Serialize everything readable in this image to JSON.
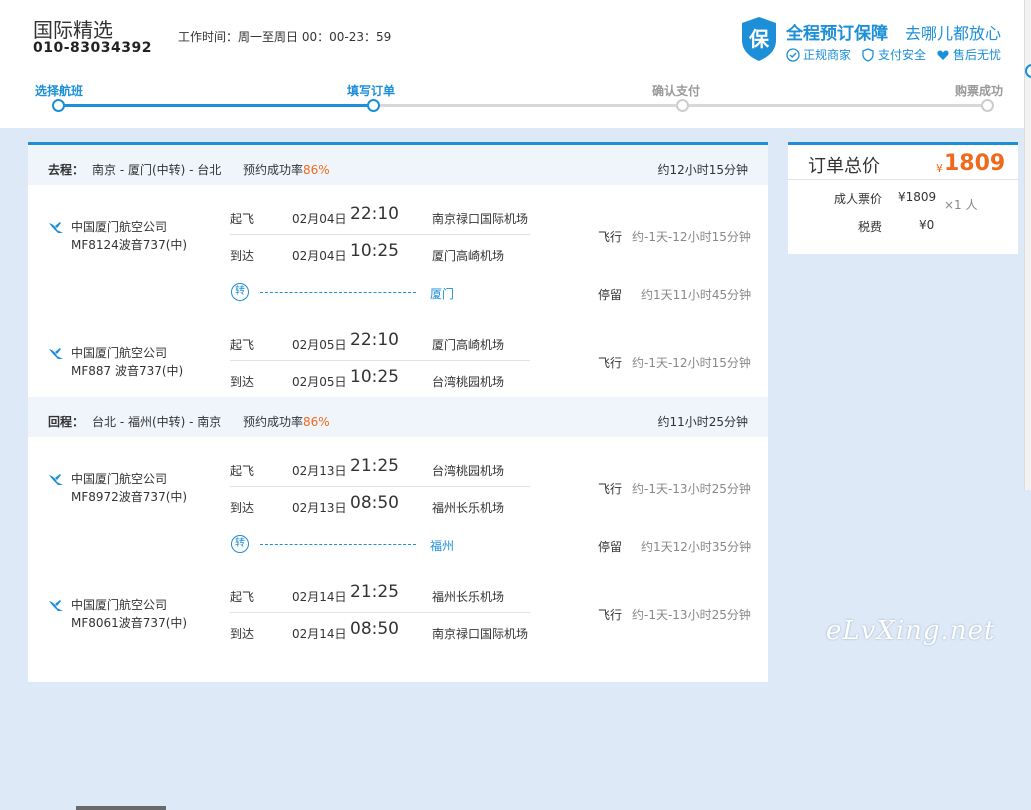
{
  "header": {
    "brand": "国际精选",
    "phone": "010-83034392",
    "hours_label": "工作时间：周一至周日",
    "hours_time": "00：00-23：59",
    "guarantee_title": "全程预订保障",
    "guarantee_slogan": "去哪儿都放心",
    "shield_char": "保",
    "badges": [
      "正规商家",
      "支付安全",
      "售后无忧"
    ]
  },
  "steps": [
    {
      "label": "选择航班",
      "state": "done"
    },
    {
      "label": "填写订单",
      "state": "current"
    },
    {
      "label": "确认支付",
      "state": "todo"
    },
    {
      "label": "购票成功",
      "state": "todo"
    }
  ],
  "outbound": {
    "label": "去程：",
    "route": "南京 - 厦门(中转) - 台北",
    "rate_label": "预约成功率",
    "rate_value": "86%",
    "total": "约12小时15分钟",
    "segments": [
      {
        "airline": "中国厦门航空公司",
        "flight": "MF8124波音737(中)",
        "dep_label": "起飞",
        "dep_date": "02月04日",
        "dep_time": "22:10",
        "dep_airport": "南京禄口国际机场",
        "arr_label": "到达",
        "arr_date": "02月04日",
        "arr_time": "10:25",
        "arr_airport": "厦门高崎机场",
        "fly_label": "飞行",
        "fly_dur": "约-1天-12小时15分钟"
      },
      {
        "airline": "中国厦门航空公司",
        "flight": "MF887  波音737(中)",
        "dep_label": "起飞",
        "dep_date": "02月05日",
        "dep_time": "22:10",
        "dep_airport": "厦门高崎机场",
        "arr_label": "到达",
        "arr_date": "02月05日",
        "arr_time": "10:25",
        "arr_airport": "台湾桃园机场",
        "fly_label": "飞行",
        "fly_dur": "约-1天-12小时15分钟"
      }
    ],
    "transfer": {
      "icon": "转",
      "city": "厦门",
      "stop_label": "停留",
      "stop_dur": "约1天11小时45分钟"
    }
  },
  "return": {
    "label": "回程：",
    "route": "台北 - 福州(中转) - 南京",
    "rate_label": "预约成功率",
    "rate_value": "86%",
    "total": "约11小时25分钟",
    "segments": [
      {
        "airline": "中国厦门航空公司",
        "flight": "MF8972波音737(中)",
        "dep_label": "起飞",
        "dep_date": "02月13日",
        "dep_time": "21:25",
        "dep_airport": "台湾桃园机场",
        "arr_label": "到达",
        "arr_date": "02月13日",
        "arr_time": "08:50",
        "arr_airport": "福州长乐机场",
        "fly_label": "飞行",
        "fly_dur": "约-1天-13小时25分钟"
      },
      {
        "airline": "中国厦门航空公司",
        "flight": "MF8061波音737(中)",
        "dep_label": "起飞",
        "dep_date": "02月14日",
        "dep_time": "21:25",
        "dep_airport": "福州长乐机场",
        "arr_label": "到达",
        "arr_date": "02月14日",
        "arr_time": "08:50",
        "arr_airport": "南京禄口国际机场",
        "fly_label": "飞行",
        "fly_dur": "约-1天-13小时25分钟"
      }
    ],
    "transfer": {
      "icon": "转",
      "city": "福州",
      "stop_label": "停留",
      "stop_dur": "约1天12小时35分钟"
    }
  },
  "summary": {
    "title": "订单总价",
    "currency": "¥",
    "total": "1809",
    "adult_label": "成人票价",
    "adult_price": "¥1809",
    "multiplier": "×1 人",
    "tax_label": "税费",
    "tax_value": "¥0"
  },
  "watermark": "eLvXing.net",
  "colors": {
    "accent": "#1d8fd8",
    "price": "#f06a1e",
    "background": "#dde9f7"
  }
}
